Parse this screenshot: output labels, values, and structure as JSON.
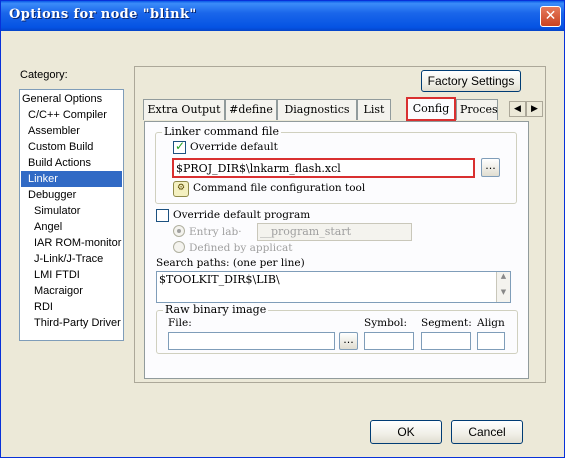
{
  "window": {
    "title": "Options for node \"blink\"",
    "close_glyph": "✕"
  },
  "category": {
    "label": "Category:",
    "items": [
      "General Options",
      "C/C++ Compiler",
      "Assembler",
      "Custom Build",
      "Build Actions",
      "Linker",
      "Debugger",
      "Simulator",
      "Angel",
      "IAR ROM-monitor",
      "J-Link/J-Trace",
      "LMI FTDI",
      "Macraigor",
      "RDI",
      "Third-Party Driver"
    ],
    "selected": "Linker"
  },
  "factory_settings_label": "Factory Settings",
  "tabs": [
    "Extra Output",
    "#define",
    "Diagnostics",
    "List",
    "Config",
    "Proces"
  ],
  "active_tab": "Config",
  "linker_cmd": {
    "group_label": "Linker command file",
    "override_label": "Override default",
    "override_checked": true,
    "path_value": "$PROJ_DIR$\\lnkarm_flash.xcl",
    "browse_label": "...",
    "tool_label": "Command file configuration tool"
  },
  "override_program": {
    "label": "Override default program",
    "checked": false,
    "entry_label": "Entry lab·",
    "entry_value": "__program_start",
    "defined_label": "Defined by applicat"
  },
  "search_paths": {
    "label": "Search paths:  (one per line)",
    "value": "$TOOLKIT_DIR$\\LIB\\"
  },
  "raw_binary": {
    "group_label": "Raw binary image",
    "file_label": "File:",
    "symbol_label": "Symbol:",
    "segment_label": "Segment:",
    "align_label": "Align",
    "browse_label": "..."
  },
  "ok_label": "OK",
  "cancel_label": "Cancel",
  "colors": {
    "title_bar": "#0553e3",
    "selection": "#316ac5",
    "highlight_box": "#d93030"
  }
}
